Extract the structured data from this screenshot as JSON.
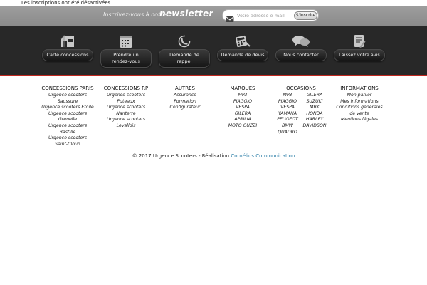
{
  "notice": "Les inscriptions ont été désactivées.",
  "newsletter": {
    "lead": "Inscrivez-vous à notre",
    "strong": "newsletter",
    "placeholder": "Votre adresse e-mail",
    "submit": "S'inscrire",
    "mail_icon": "envelope-icon"
  },
  "services": [
    {
      "label": "Carte concessions",
      "icon": "store-icon"
    },
    {
      "label": "Prendre un rendez-vous",
      "icon": "calendar-icon"
    },
    {
      "label": "Demande de rappel",
      "icon": "phone-icon"
    },
    {
      "label": "Demande de devis",
      "icon": "calculator-icon"
    },
    {
      "label": "Nous contacter",
      "icon": "chat-icon"
    },
    {
      "label": "Laissez votre avis",
      "icon": "review-icon"
    }
  ],
  "footer": {
    "paris": {
      "title": "CONCESSIONS PARIS",
      "links": [
        "Urgence scooters Saussure",
        "Urgence scooters Etoile",
        "Urgence scooters Grenelle",
        "Urgence scooters Bastille",
        "Urgence scooters Saint-Cloud"
      ]
    },
    "rp": {
      "title": "CONCESSIONS RP",
      "links": [
        "Urgence scooters Puteaux",
        "Urgence scooters Nanterre",
        "Urgence scooters Levallois"
      ]
    },
    "autres": {
      "title": "AUTRES",
      "links": [
        "Assurance",
        "Formation",
        "Configurateur"
      ]
    },
    "marques": {
      "title": "MARQUES",
      "links": [
        "MP3",
        "PIAGGIO",
        "VESPA",
        "GILERA",
        "APRILIA",
        "MOTO GUZZI"
      ]
    },
    "occasions": {
      "title": "OCCASIONS",
      "left": [
        "MP3",
        "PIAGGIO",
        "VESPA",
        "YAMAHA",
        "PEUGEOT",
        "BMW",
        "QUADRO"
      ],
      "right": [
        "GILERA",
        "SUZUKI",
        "MBK",
        "HONDA",
        "HARLEY DAVIDSON"
      ]
    },
    "informations": {
      "title": "INFORMATIONS",
      "links": [
        "Mon panier",
        "Mes informations",
        "Conditions générales de vente",
        "Mentions légales"
      ]
    }
  },
  "copyright": {
    "text": "© 2017 Urgence Scooters - Réalisation",
    "link": "Cornélius Communication"
  }
}
